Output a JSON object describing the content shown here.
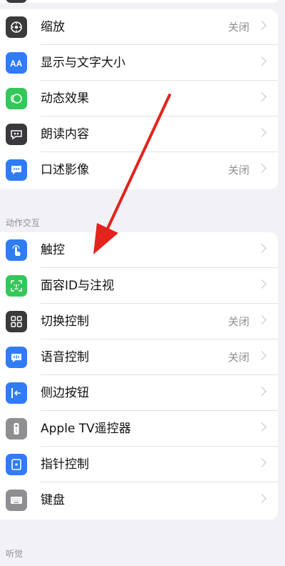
{
  "vision": {
    "items": [
      {
        "label": "缩放",
        "value": "关闭"
      },
      {
        "label": "显示与文字大小",
        "value": ""
      },
      {
        "label": "动态效果",
        "value": ""
      },
      {
        "label": "朗读内容",
        "value": ""
      },
      {
        "label": "口述影像",
        "value": "关闭"
      }
    ]
  },
  "physical": {
    "header": "动作交互",
    "items": [
      {
        "label": "触控",
        "value": ""
      },
      {
        "label": "面容ID与注视",
        "value": ""
      },
      {
        "label": "切换控制",
        "value": "关闭"
      },
      {
        "label": "语音控制",
        "value": "关闭"
      },
      {
        "label": "侧边按钮",
        "value": ""
      },
      {
        "label": "Apple TV遥控器",
        "value": ""
      },
      {
        "label": "指针控制",
        "value": ""
      },
      {
        "label": "键盘",
        "value": ""
      }
    ]
  },
  "hearing": {
    "header": "听觉"
  },
  "icons": {
    "zoom": "zoom-icon",
    "text_size": "text-size-icon",
    "motion": "motion-icon",
    "spoken": "spoken-content-icon",
    "audio_desc": "audio-descriptions-icon",
    "touch": "touch-icon",
    "face_id": "face-id-icon",
    "switch": "switch-control-icon",
    "voice": "voice-control-icon",
    "side": "side-button-icon",
    "remote": "apple-tv-remote-icon",
    "pointer": "pointer-control-icon",
    "keyboard": "keyboard-icon"
  },
  "colors": {
    "blue": "#2f7cf6",
    "green": "#34c759",
    "dark": "#3a3a3c",
    "gray": "#8e8e93",
    "annotation_red": "#e3231c"
  }
}
